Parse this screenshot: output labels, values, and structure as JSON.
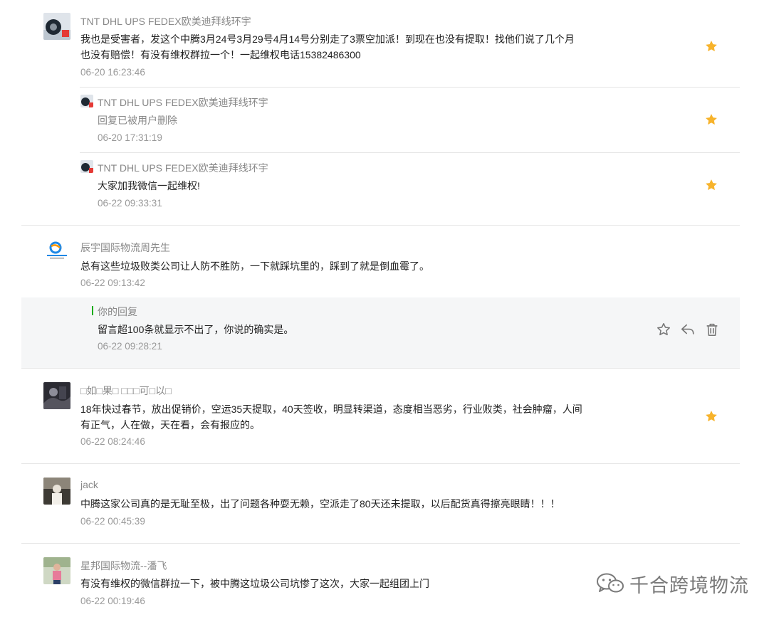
{
  "colors": {
    "star": "#f7b32b",
    "nick": "#888888",
    "time": "#999999",
    "content": "#222222",
    "mine_bar": "#1aad19",
    "mine_bg": "#f5f6f7"
  },
  "comments": [
    {
      "nickname": "TNT DHL UPS FEDEX欧美迪拜线环宇",
      "content_line1": "我也是受害者，发这个中腾3月24号3月29号4月14号分别走了3票空加派！到现在也没有提取！找他们说了几个月",
      "content_line2": "也没有赔偿！有没有维权群拉一个！一起维权电话15382486300",
      "time": "06-20 16:23:46",
      "avatar_icon": "profile-photo",
      "starred": true,
      "replies": [
        {
          "nickname": "TNT DHL UPS FEDEX欧美迪拜线环宇",
          "content": "回复已被用户删除",
          "time": "06-20 17:31:19",
          "starred": true
        },
        {
          "nickname": "TNT DHL UPS FEDEX欧美迪拜线环宇",
          "content": "大家加我微信一起维权!",
          "time": "06-22 09:33:31",
          "starred": true
        }
      ]
    },
    {
      "nickname": "辰宇国际物流周先生",
      "content": "总有这些垃圾败类公司让人防不胜防，一下就踩坑里的，踩到了就是倒血霉了。",
      "time": "06-22 09:13:42",
      "avatar_icon": "logo",
      "my_reply": {
        "label": "你的回复",
        "content": "留言超100条就显示不出了，你说的确实是。",
        "time": "06-22 09:28:21"
      }
    },
    {
      "nickname": "□如□果□ □□□可□以□",
      "content_line1": "18年快过春节，放出促销价，空运35天提取，40天签收，明显转渠道，态度相当恶劣，行业败类，社会肿瘤，人间",
      "content_line2": "有正气，人在做，天在看，会有报应的。",
      "time": "06-22 08:24:46",
      "avatar_icon": "profile-photo",
      "starred": true
    },
    {
      "nickname": "jack",
      "content": "中腾这家公司真的是无耻至极，出了问题各种耍无赖，空派走了80天还未提取，以后配货真得擦亮眼睛！！！",
      "time": "06-22 00:45:39",
      "avatar_icon": "profile-photo"
    },
    {
      "nickname": "星邦国际物流--潘飞",
      "content": "有没有维权的微信群拉一下，被中腾这垃圾公司坑惨了这次，大家一起组团上门",
      "time": "06-22 00:19:46",
      "avatar_icon": "profile-photo"
    }
  ],
  "watermark": {
    "text": "千合跨境物流",
    "icon": "wechat-icon"
  }
}
